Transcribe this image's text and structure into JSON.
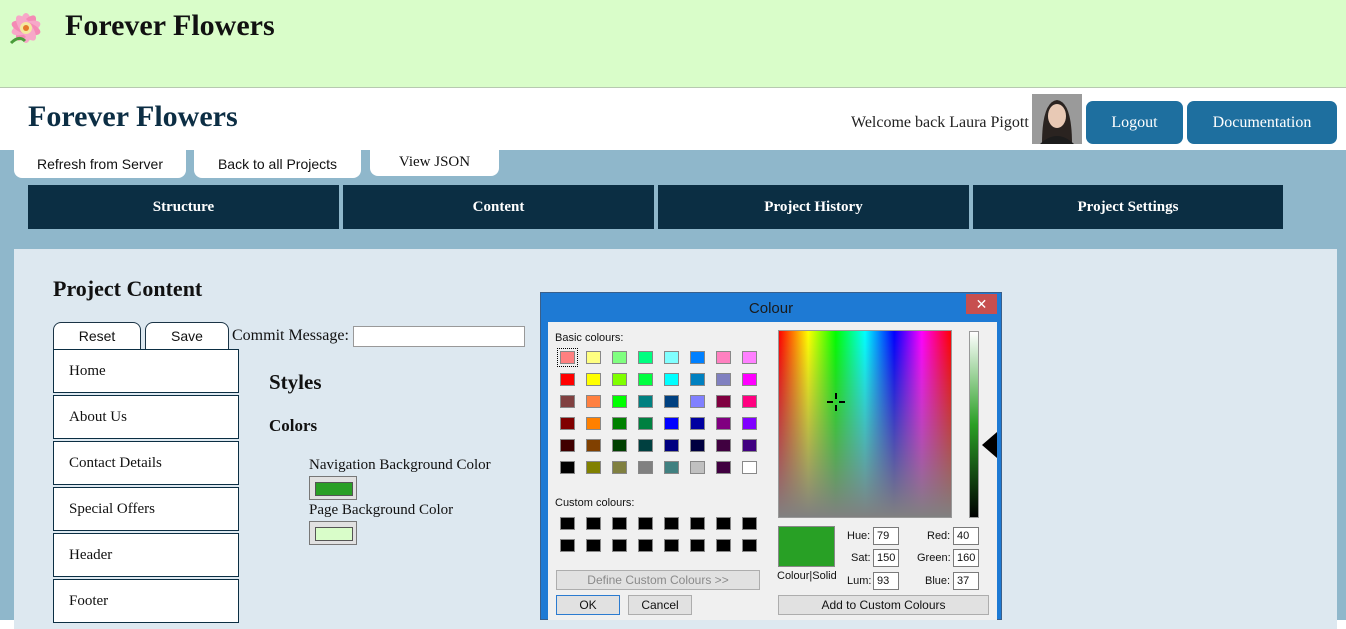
{
  "preview": {
    "title": "Forever Flowers"
  },
  "header": {
    "title": "Forever Flowers",
    "welcome": "Welcome back Laura Pigott",
    "logout": "Logout",
    "documentation": "Documentation"
  },
  "toolbar": {
    "refresh": "Refresh from Server",
    "back": "Back to all Projects",
    "view_json": "View JSON"
  },
  "nav": [
    "Structure",
    "Content",
    "Project History",
    "Project Settings"
  ],
  "content": {
    "title": "Project Content",
    "reset": "Reset",
    "save": "Save",
    "commit_label": "Commit Message:",
    "commit_value": ""
  },
  "pages": [
    "Home",
    "About Us",
    "Contact Details",
    "Special Offers",
    "Header",
    "Footer"
  ],
  "styles": {
    "title": "Styles",
    "colors_title": "Colors",
    "nav_bg_label": "Navigation Background Color",
    "nav_bg_color": "#2a9f25",
    "page_bg_label": "Page Background Color",
    "page_bg_color": "#d9fdc9"
  },
  "dialog": {
    "title": "Colour",
    "close": "✕",
    "basic_label": "Basic colours:",
    "custom_label": "Custom colours:",
    "define_custom": "Define Custom Colours >>",
    "ok": "OK",
    "cancel": "Cancel",
    "add_custom": "Add to Custom Colours",
    "colour_solid": "Colour|Solid",
    "fields": {
      "hue_label": "Hue:",
      "hue": "79",
      "sat_label": "Sat:",
      "sat": "150",
      "lum_label": "Lum:",
      "lum": "93",
      "red_label": "Red:",
      "red": "40",
      "green_label": "Green:",
      "green": "160",
      "blue_label": "Blue:",
      "blue": "37"
    },
    "basic_colours": [
      "#ff8080",
      "#ffff80",
      "#80ff80",
      "#00ff80",
      "#80ffff",
      "#0080ff",
      "#ff80c0",
      "#ff80ff",
      "#ff0000",
      "#ffff00",
      "#80ff00",
      "#00ff40",
      "#00ffff",
      "#0080c0",
      "#8080c0",
      "#ff00ff",
      "#804040",
      "#ff8040",
      "#00ff00",
      "#008080",
      "#004080",
      "#8080ff",
      "#800040",
      "#ff0080",
      "#800000",
      "#ff8000",
      "#008000",
      "#008040",
      "#0000ff",
      "#0000a0",
      "#800080",
      "#8000ff",
      "#400000",
      "#804000",
      "#004000",
      "#004040",
      "#000080",
      "#000040",
      "#400040",
      "#400080",
      "#000000",
      "#808000",
      "#808040",
      "#808080",
      "#408080",
      "#c0c0c0",
      "#400040",
      "#ffffff"
    ],
    "custom_colours": [
      "#000000",
      "#000000",
      "#000000",
      "#000000",
      "#000000",
      "#000000",
      "#000000",
      "#000000",
      "#000000",
      "#000000",
      "#000000",
      "#000000",
      "#000000",
      "#000000",
      "#000000",
      "#000000"
    ],
    "selected_colour": "#28a025"
  }
}
